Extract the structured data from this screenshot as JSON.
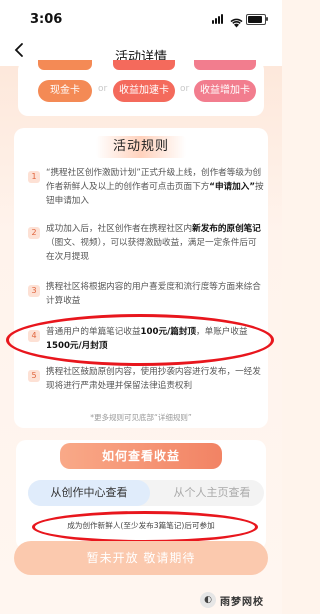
{
  "status": {
    "time": "3:06"
  },
  "nav": {
    "back_icon": "chevron-left-icon",
    "title": "活动详情"
  },
  "top_cards": {
    "pills": [
      "现金卡",
      "收益加速卡",
      "收益增加卡"
    ],
    "or": "or"
  },
  "rules": {
    "title": "活动规则",
    "items": [
      {
        "num": "1",
        "html": "“携程社区创作激励计划”正式升级上线，创作者等级为创作者新鲜人及以上的创作者可点击页面下方<b>“申请加入”</b>按钮申请加入"
      },
      {
        "num": "2",
        "html": "成功加入后，社区创作者在携程社区内<b>新发布的原创笔记</b>（图文、视频），可以获得激励收益，满足一定条件后可在次月提现"
      },
      {
        "num": "3",
        "html": "携程社区将根据内容的用户喜爱度和流行度等方面来综合计算收益"
      },
      {
        "num": "4",
        "html": "普通用户的单篇笔记收益<b>100元/篇封顶</b>，单账户收益<b>1500元/月封顶</b>"
      },
      {
        "num": "5",
        "html": "携程社区鼓励原创内容，使用抄袭内容进行发布，一经发现将进行严肃处理并保留法律追责权利"
      }
    ],
    "note": "*更多规则可见底部“详细规则”"
  },
  "earnings": {
    "title": "如何查看收益",
    "tab_active": "从创作中心查看",
    "tab_inactive": "从个人主页查看",
    "condition": "成为创作新鲜人(至少发布3篇笔记)后可参加",
    "cta": "暂未开放 敬请期待"
  },
  "watermark": {
    "name": "雨梦网校"
  },
  "colors": {
    "accent": "#f27a58",
    "annotation_red": "#e8161d"
  }
}
